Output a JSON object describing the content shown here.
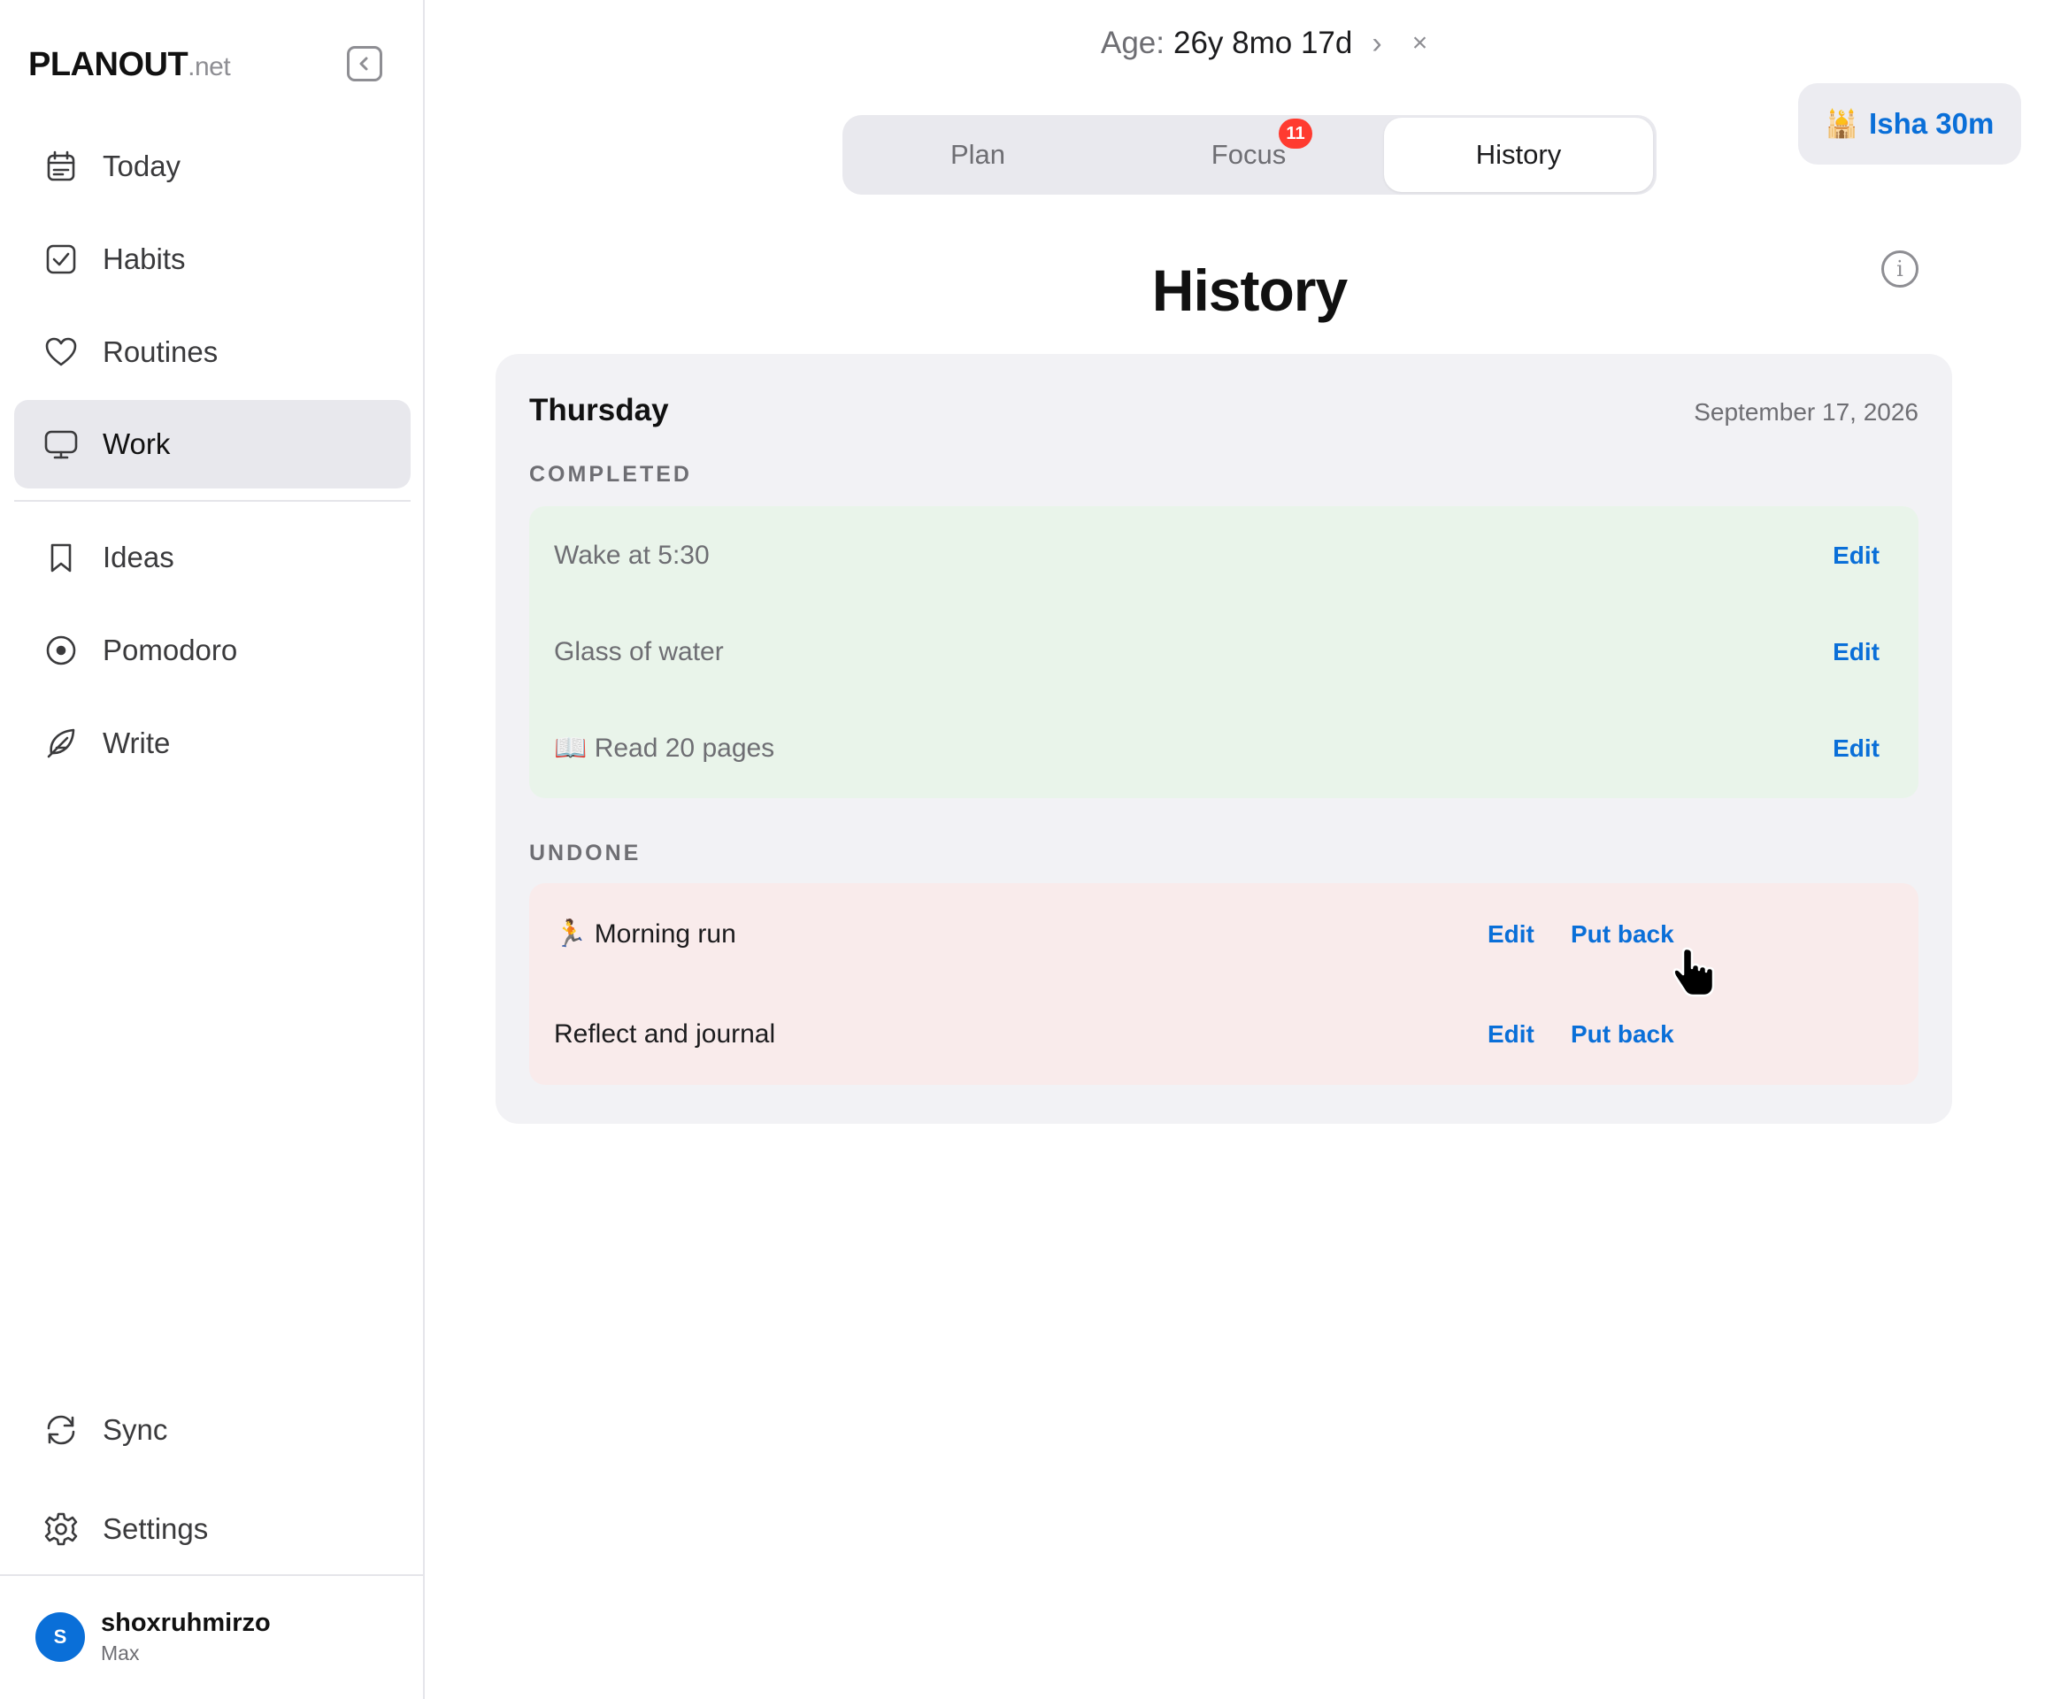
{
  "brand": {
    "name": "PLANOUT",
    "suffix": ".net"
  },
  "sidebar": {
    "items": [
      {
        "label": "Today",
        "icon": "calendar-icon"
      },
      {
        "label": "Habits",
        "icon": "checkbox-icon"
      },
      {
        "label": "Routines",
        "icon": "heart-icon"
      },
      {
        "label": "Work",
        "icon": "monitor-icon",
        "active": true
      },
      {
        "label": "Ideas",
        "icon": "bookmark-icon"
      },
      {
        "label": "Pomodoro",
        "icon": "target-icon"
      },
      {
        "label": "Write",
        "icon": "feather-icon"
      }
    ],
    "bottom": [
      {
        "label": "Sync",
        "icon": "sync-icon"
      },
      {
        "label": "Settings",
        "icon": "gear-icon"
      }
    ],
    "user": {
      "initial": "S",
      "name": "shoxruhmirzo",
      "plan": "Max"
    }
  },
  "age": {
    "label": "Age:",
    "value": "26y 8mo 17d",
    "next": "›",
    "close": "×"
  },
  "tabs": [
    {
      "label": "Plan"
    },
    {
      "label": "Focus",
      "badge": "11"
    },
    {
      "label": "History",
      "selected": true
    }
  ],
  "prayer": {
    "emoji": "🕌",
    "label": "Isha 30m"
  },
  "page": {
    "title": "History",
    "info": "i"
  },
  "day": {
    "name": "Thursday",
    "date": "September 17, 2026",
    "completed_label": "COMPLETED",
    "completed": [
      {
        "text": "Wake at 5:30",
        "edit": "Edit"
      },
      {
        "text": "Glass of water",
        "edit": "Edit"
      },
      {
        "text": "📖 Read 20 pages",
        "edit": "Edit"
      }
    ],
    "undone_label": "UNDONE",
    "undone": [
      {
        "text": "🏃 Morning run",
        "edit": "Edit",
        "put_back": "Put back"
      },
      {
        "text": "Reflect and journal",
        "edit": "Edit",
        "put_back": "Put back"
      }
    ]
  },
  "colors": {
    "accent": "#0a6fd8",
    "badge": "#ff3b30",
    "completed_bg": "#e9f4ea",
    "undone_bg": "#f9ebeb"
  }
}
